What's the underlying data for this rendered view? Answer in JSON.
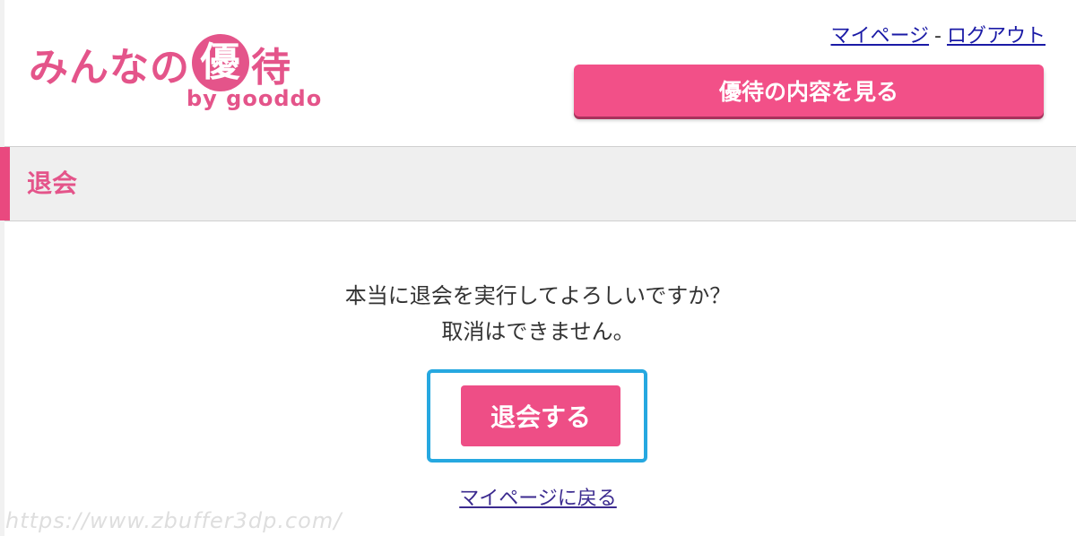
{
  "logo": {
    "text_before": "みんなの",
    "circle_char": "優",
    "text_after": "待",
    "sub": "by gooddo"
  },
  "top_nav": {
    "mypage_label": "マイページ",
    "separator": "-",
    "logout_label": "ログアウト"
  },
  "header": {
    "cta_label": "優待の内容を見る"
  },
  "section": {
    "title": "退会"
  },
  "confirm": {
    "line1": "本当に退会を実行してよろしいですか？",
    "line2": "取消はできません。",
    "withdraw_button_label": "退会する",
    "back_link_label": "マイページに戻る"
  },
  "watermark": "https://www.zbuffer3dp.com/",
  "colors": {
    "brand_pink": "#e4548a",
    "button_pink": "#f25088",
    "highlight_blue": "#26a8e0",
    "link_blue": "#1a1aa6"
  }
}
